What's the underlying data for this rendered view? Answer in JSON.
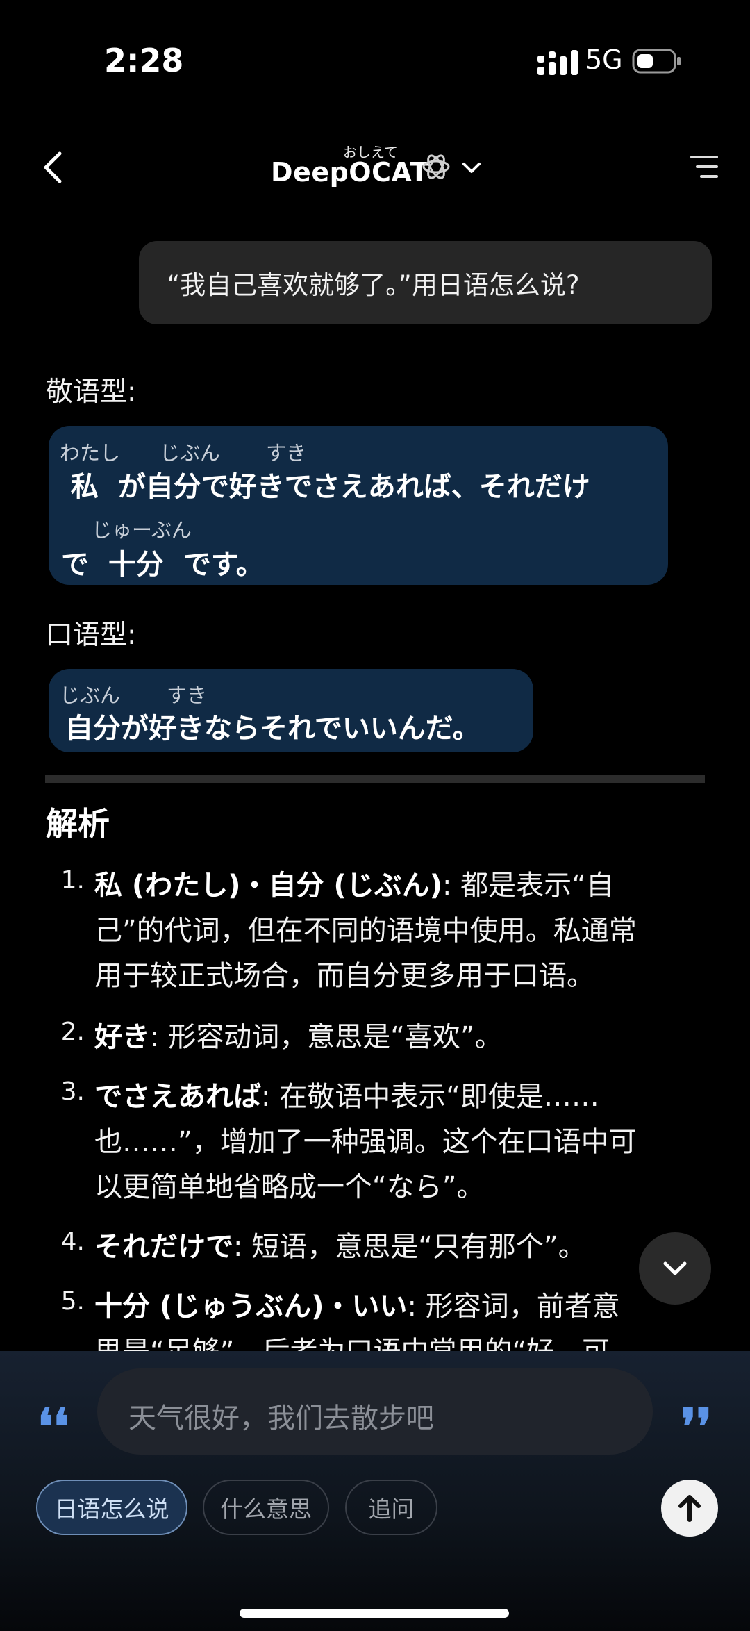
{
  "status": {
    "time": "2:28",
    "network": "5G"
  },
  "header": {
    "title": "DeepOCAT",
    "title_ruby": "おしえて"
  },
  "user_message": "“我自己喜欢就够了。”用日语怎么说?",
  "formal": {
    "label": "敬语型:",
    "line1_ruby": [
      "わたし",
      "じぶん",
      "すき"
    ],
    "line1": " 私  が自分で好きでさえあれば、それだけ",
    "line2_ruby": [
      "じゅーぶん"
    ],
    "line2": "で  十分  です。"
  },
  "casual": {
    "label": "口语型:",
    "ruby": [
      "じぶん",
      "すき"
    ],
    "text": "自分が好きならそれでいいんだ。"
  },
  "analysis": {
    "title": "解析",
    "items": [
      {
        "num": "1.",
        "term": "私 (わたし)・自分 (じぶん)",
        "lines": [
          ": 都是表示“自",
          "己”的代词，但在不同的语境中使用。私通常",
          "用于较正式场合，而自分更多用于口语。"
        ]
      },
      {
        "num": "2.",
        "term": "好き",
        "lines": [
          ": 形容动词，意思是“喜欢”。"
        ]
      },
      {
        "num": "3.",
        "term": "でさえあれば",
        "lines": [
          ": 在敬语中表示“即使是……",
          "也……”，增加了一种强调。这个在口语中可",
          "以更简单地省略成一个“なら”。"
        ]
      },
      {
        "num": "4.",
        "term": "それだけで",
        "lines": [
          ": 短语，意思是“只有那个”。"
        ]
      },
      {
        "num": "5.",
        "term": "十分 (じゅうぶん)・いい",
        "lines": [
          ": 形容词，前者意",
          "思是“足够”，后者为口语中常用的“好、可"
        ]
      }
    ]
  },
  "input": {
    "placeholder": "天气很好，我们去散步吧",
    "open_quote": "❛❛",
    "close_quote": "❜❜"
  },
  "chips": [
    "日语怎么说",
    "什么意思",
    "追问"
  ],
  "colors": {
    "accent": "#5a92e6",
    "bubble_jp": "#102a45",
    "bubble_user": "#262626"
  }
}
